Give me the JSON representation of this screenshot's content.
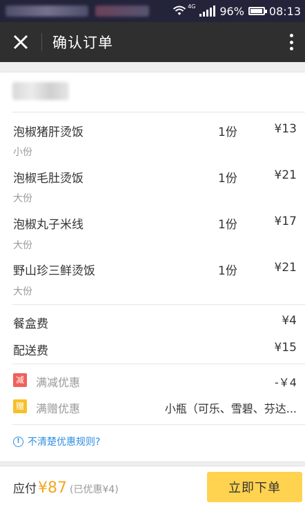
{
  "status_bar": {
    "network": "4G",
    "battery": "96%",
    "time": "08:13"
  },
  "header": {
    "title": "确认订单",
    "close_icon": "close-icon",
    "more_icon": "more-vertical-icon"
  },
  "order": {
    "items": [
      {
        "name": "泡椒猪肝烫饭",
        "spec": "小份",
        "qty": "1份",
        "price": "¥13"
      },
      {
        "name": "泡椒毛肚烫饭",
        "spec": "大份",
        "qty": "1份",
        "price": "¥21"
      },
      {
        "name": "泡椒丸子米线",
        "spec": "大份",
        "qty": "1份",
        "price": "¥17"
      },
      {
        "name": "野山珍三鲜烫饭",
        "spec": "大份",
        "qty": "1份",
        "price": "¥21"
      }
    ],
    "fees": [
      {
        "label": "餐盒费",
        "value": "¥4"
      },
      {
        "label": "配送费",
        "value": "¥15"
      }
    ],
    "promos": [
      {
        "badge": "减",
        "label": "满减优惠",
        "value": "-￥4",
        "color": "#f0605a"
      },
      {
        "badge": "赠",
        "label": "满赠优惠",
        "value": "小瓶（可乐、雪碧、芬达...",
        "color": "#f6c026"
      }
    ],
    "help_text": "不清楚优惠规则?"
  },
  "footer": {
    "pay_label": "应付",
    "pay_amount": "¥87",
    "discount_note": "(已优惠¥4)",
    "submit_label": "立即下单"
  },
  "colors": {
    "accent": "#ffd24f",
    "price_highlight": "#f5a623",
    "link": "#2f8ee0",
    "header_bg": "#2f2f2f"
  }
}
